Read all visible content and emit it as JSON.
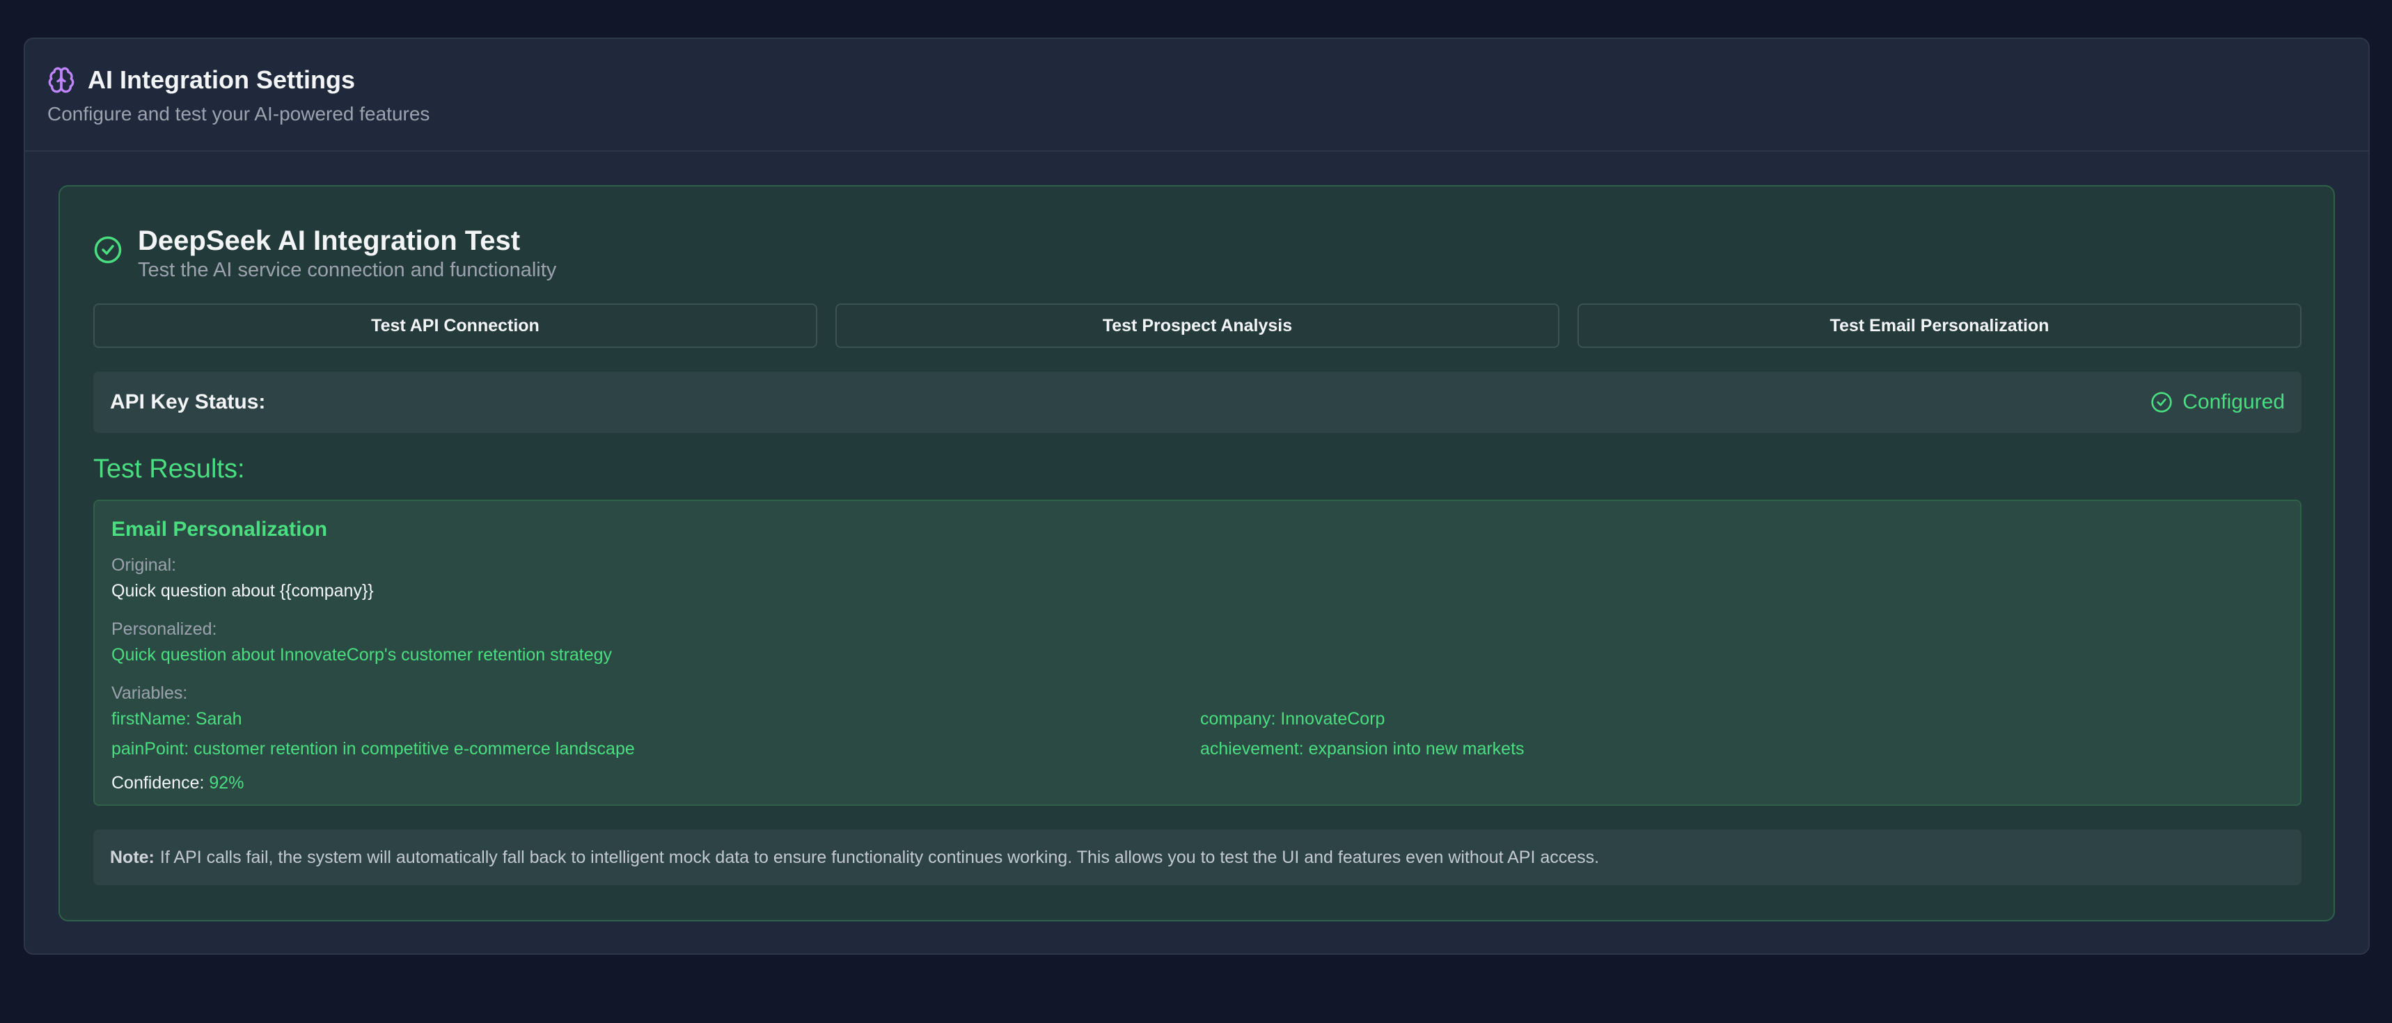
{
  "header": {
    "icon": "brain-icon",
    "title": "AI Integration Settings",
    "subtitle": "Configure and test your AI-powered features"
  },
  "test_panel": {
    "icon": "check-circle-icon",
    "title": "DeepSeek AI Integration Test",
    "subtitle": "Test the AI service connection and functionality",
    "buttons": [
      {
        "label": "Test API Connection"
      },
      {
        "label": "Test Prospect Analysis"
      },
      {
        "label": "Test Email Personalization"
      }
    ],
    "api_key_status": {
      "label": "API Key Status:",
      "value": "Configured",
      "icon": "check-circle-icon",
      "color": "#4ade80"
    },
    "results_title": "Test Results:",
    "result": {
      "title": "Email Personalization",
      "original_label": "Original:",
      "original_value": "Quick question about {{company}}",
      "personalized_label": "Personalized:",
      "personalized_value": "Quick question about InnovateCorp's customer retention strategy",
      "variables_label": "Variables:",
      "variables": [
        "firstName: Sarah",
        "company: InnovateCorp",
        "painPoint: customer retention in competitive e-commerce landscape",
        "achievement: expansion into new markets"
      ],
      "confidence_label": "Confidence:",
      "confidence_value": "92%"
    },
    "note": {
      "label": "Note:",
      "text": "If API calls fail, the system will automatically fall back to intelligent mock data to ensure functionality continues working. This allows you to test the UI and features even without API access."
    }
  },
  "colors": {
    "background": "#111729",
    "card": "#1f293b",
    "accent_green": "#4ade80",
    "brain_icon": "#c084fc"
  }
}
